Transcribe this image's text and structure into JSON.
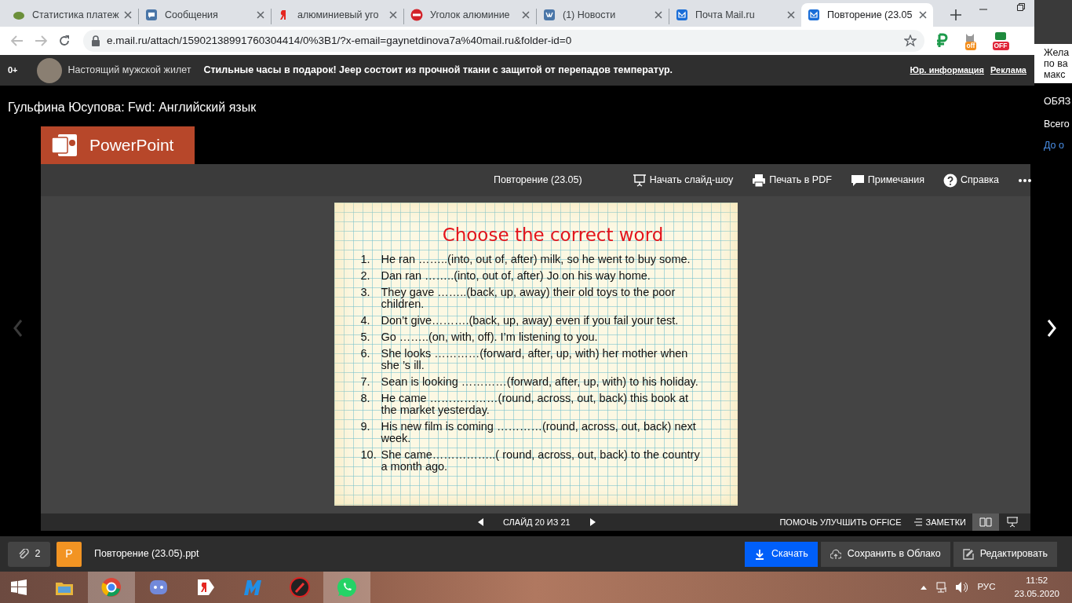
{
  "browser": {
    "tabs": [
      {
        "title": "Статистика платеж",
        "selected": false
      },
      {
        "title": "Сообщения",
        "selected": false
      },
      {
        "title": "алюминиевый уго",
        "selected": false
      },
      {
        "title": "Уголок алюминие",
        "selected": false
      },
      {
        "title": "(1) Новости",
        "selected": false
      },
      {
        "title": "Почта Mail.ru",
        "selected": false
      },
      {
        "title": "Повторение (23.05",
        "selected": true
      }
    ],
    "url": "e.mail.ru/attach/15902138991760304414/0%3B1/?x-email=gaynetdinova7a%40mail.ru&folder-id=0",
    "extension_badges": [
      "off",
      "OFF"
    ]
  },
  "ad_bar": {
    "age": "0+",
    "headline": "Настоящий мужской жилет",
    "text": "Стильные часы в подарок! Jeep состоит из прочной ткани с защитой от перепадов температур.",
    "links": [
      "Юр. информация",
      "Реклама"
    ]
  },
  "email_subject": "Гульфина Юсупова: Fwd: Английский язык",
  "viewer": {
    "app": "PowerPoint",
    "doc_title": "Повторение (23.05)",
    "toolbar": [
      "Начать слайд-шоу",
      "Печать в PDF",
      "Примечания",
      "Справка"
    ],
    "slide": {
      "title": "Choose the correct word",
      "items": [
        {
          "num": "1.",
          "text": "He ran ……..(into, out of, after) milk, so he went to buy some."
        },
        {
          "num": "2.",
          "text": "Dan ran ……..(into, out of, after) Jo on his way home."
        },
        {
          "num": "3.",
          "text": "They gave ……..(back, up, away) their old toys to the poor children."
        },
        {
          "num": "4.",
          "text": "Don’t give……….(back, up, away) even if you fail your test."
        },
        {
          "num": "5.",
          "text": "Go ……..(on, with, off). I’m listening to you."
        },
        {
          "num": "6.",
          "text": "She looks …………(forward, after, up, with) her mother when she ’s ill."
        },
        {
          "num": "7.",
          "text": "Sean is looking …………(forward, after, up, with) to his holiday."
        },
        {
          "num": "8.",
          "text": "He came ………………(round, across, out, back) this book at the market yesterday."
        },
        {
          "num": "9.",
          "text": "His new film is coming …………(round, across, out, back) next week."
        },
        {
          "num": "10.",
          "text": "She came……………..( round, across, out, back) to the country a month ago."
        }
      ]
    },
    "prev_slide_disabled": true,
    "status": {
      "slide_counter": "СЛАЙД 20 ИЗ 21",
      "help": "ПОМОЧЬ УЛУЧШИТЬ OFFICE",
      "notes": "ЗАМЕТКИ",
      "views": [
        {
          "selected": true
        },
        {
          "selected": false
        }
      ]
    }
  },
  "attachments": {
    "count": "2",
    "file_letter": "P",
    "file_name": "Повторение (23.05).ppt",
    "buttons": [
      "Скачать",
      "Сохранить в Облако",
      "Редактировать"
    ]
  },
  "side_panel": {
    "lines": [
      "Жела",
      "по ва",
      "макс"
    ],
    "headings": [
      "ОБЯЗ",
      "Всего"
    ],
    "link": "До о"
  },
  "taskbar": {
    "apps": [
      {
        "selected": false
      },
      {
        "selected": true
      },
      {
        "selected": false
      },
      {
        "selected": false
      },
      {
        "selected": false
      },
      {
        "selected": false
      },
      {
        "selected": true
      }
    ],
    "language": "РУС",
    "time": "11:52",
    "date": "23.05.2020"
  }
}
